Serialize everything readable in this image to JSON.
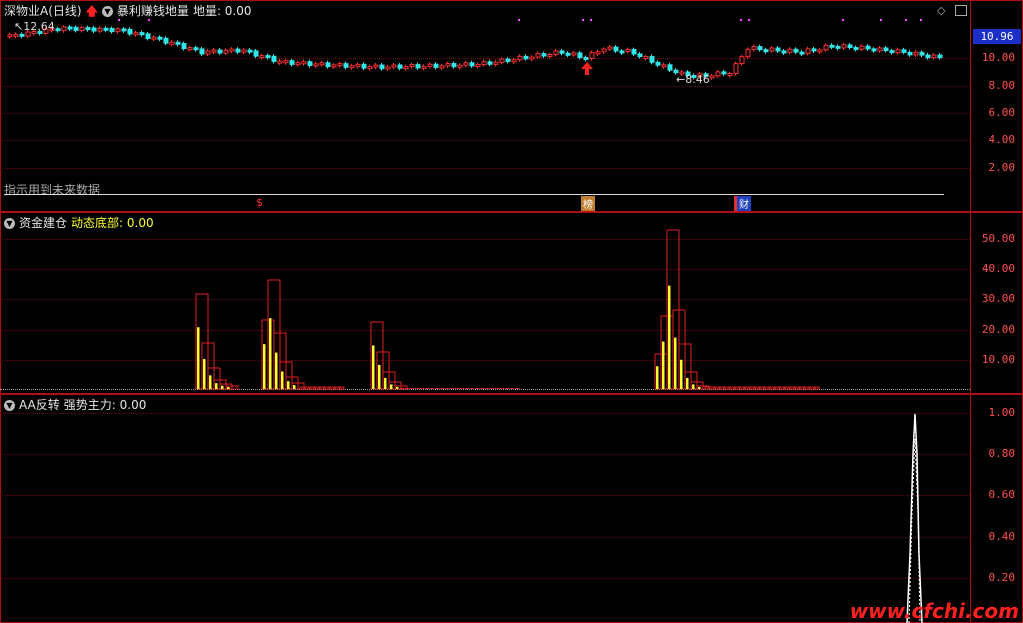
{
  "main": {
    "stock_label": "深物业A(日线)",
    "indicator_name": "暴利赚钱地量",
    "indicator_value_label": "地量: 0.00",
    "high_mark": "12.64",
    "low_mark": "8.46",
    "current_price": "10.96",
    "note": "指示用到未来数据",
    "y_ticks": [
      "10.00",
      "8.00",
      "6.00",
      "4.00",
      "2.00"
    ],
    "markers": [
      "$",
      "榜",
      "财"
    ],
    "colors": {
      "up": "#ff3030",
      "down": "#30e6e6",
      "axis": "#b01010"
    }
  },
  "p2": {
    "indicator_name": "资金建仓",
    "value_label": "动态底部: 0.00",
    "y_ticks": [
      "50.00",
      "40.00",
      "30.00",
      "20.00",
      "10.00"
    ],
    "colors": {
      "outline": "#e02020",
      "fill": "#ffff30"
    }
  },
  "p3": {
    "indicator_name": "AA反转",
    "value_label": "强势主力: 0.00",
    "y_ticks": [
      "1.00",
      "0.80",
      "0.60",
      "0.40",
      "0.20"
    ]
  },
  "watermark": "www.cfchi.com",
  "icons": [
    "collapse-icon",
    "up-arrow-icon",
    "diamond-icon",
    "window-icon"
  ]
}
